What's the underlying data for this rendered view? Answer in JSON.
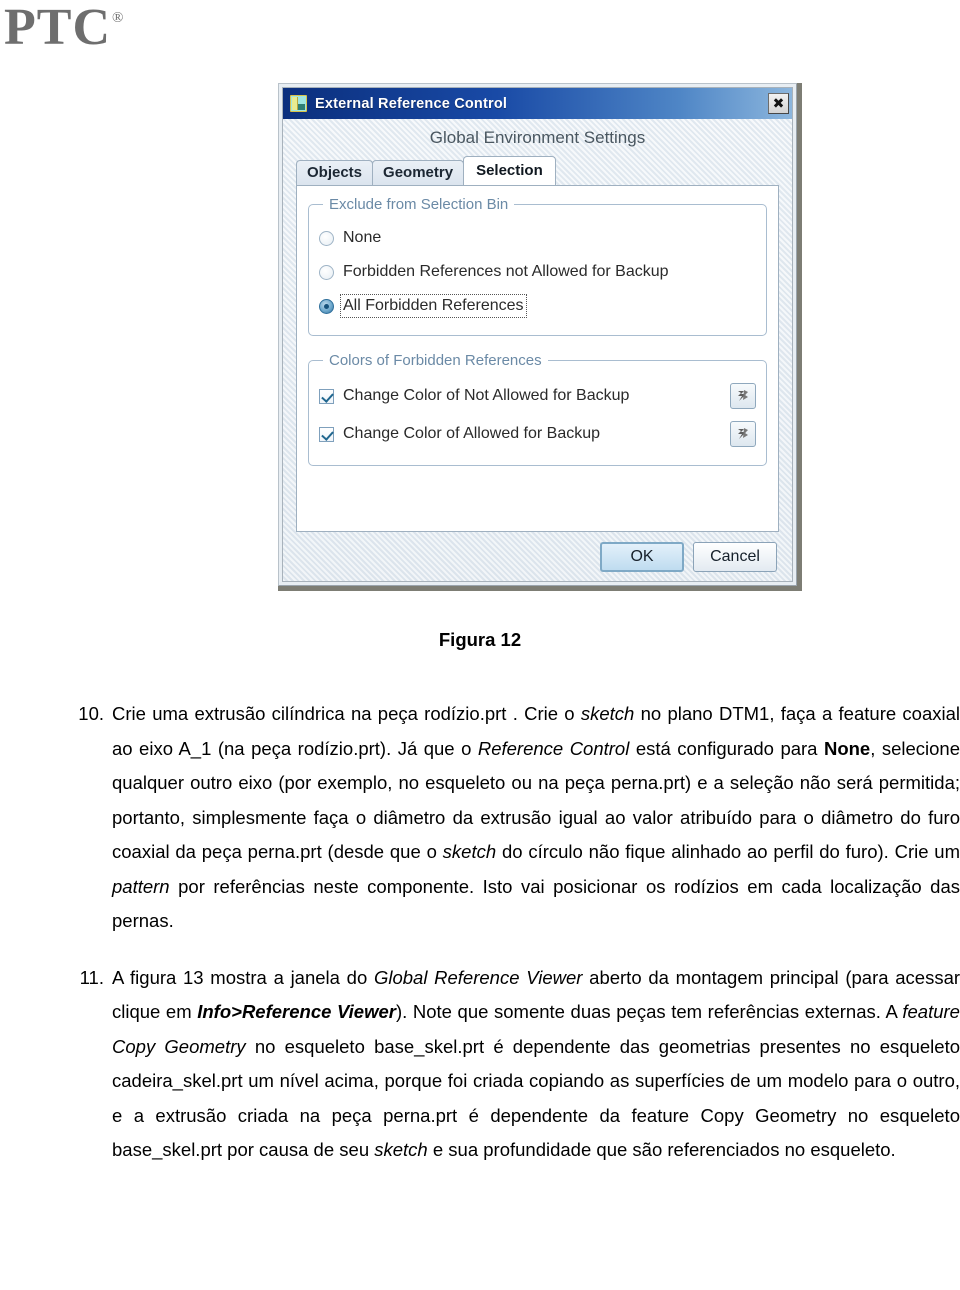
{
  "logo": {
    "text": "PTC",
    "registered": "®"
  },
  "dialog": {
    "title": "External Reference Control",
    "close_label": "✖",
    "subtitle": "Global Environment Settings",
    "tabs": [
      {
        "label": "Objects",
        "active": false
      },
      {
        "label": "Geometry",
        "active": false
      },
      {
        "label": "Selection",
        "active": true
      }
    ],
    "group_exclude": {
      "legend": "Exclude from Selection Bin",
      "options": [
        {
          "label": "None",
          "checked": false,
          "focused": false
        },
        {
          "label": "Forbidden References not Allowed for Backup",
          "checked": false,
          "focused": false
        },
        {
          "label": "All Forbidden References",
          "checked": true,
          "focused": true
        }
      ]
    },
    "group_colors": {
      "legend": "Colors of Forbidden References",
      "options": [
        {
          "label": "Change Color of Not Allowed for Backup",
          "checked": true
        },
        {
          "label": "Change Color of Allowed for Backup",
          "checked": true
        }
      ],
      "swatch_icon": "color-swatch-icon"
    },
    "buttons": {
      "ok": "OK",
      "cancel": "Cancel"
    },
    "colors": {
      "titlebar_start": "#0b2f7d",
      "titlebar_end": "#8cb6dd",
      "accent": "#2d6f9d",
      "group_border": "#a9bdd0",
      "legend_text": "#6b8aa6"
    }
  },
  "caption": "Figura 12",
  "items": [
    {
      "number": "10.",
      "html": "Crie uma extrusão cilíndrica na peça rodízio.prt . Crie o <i>sketch</i> no plano DTM1, faça a feature coaxial ao eixo A_1 (na peça rodízio.prt). Já que o <i>Reference Control</i> está configurado para <b>None</b>, selecione qualquer outro eixo (por exemplo, no esqueleto ou na peça perna.prt) e a seleção não será permitida; portanto, simplesmente faça o diâmetro da extrusão igual ao valor atribuído para o diâmetro do furo coaxial da peça perna.prt (desde que o <i>sketch</i> do círculo não fique alinhado ao perfil do furo). Crie um <i>pattern</i> por referências neste componente. Isto vai posicionar os rodízios em cada localização das pernas."
    },
    {
      "number": "11.",
      "html": "A figura 13 mostra a janela do <i>Global Reference Viewer</i> aberto da montagem principal (para acessar clique em <b><i>Info&gt;Reference Viewer</i></b>). Note que somente duas peças tem referências externas. A <i>feature Copy Geometry</i> no esqueleto base_skel.prt é dependente das geometrias presentes no esqueleto cadeira_skel.prt um nível acima, porque foi criada copiando as superfícies de um modelo para o outro, e a extrusão criada na peça perna.prt é dependente da feature Copy Geometry no esqueleto base_skel.prt por causa de seu <i>sketch</i> e sua profundidade que são referenciados no esqueleto."
    }
  ]
}
